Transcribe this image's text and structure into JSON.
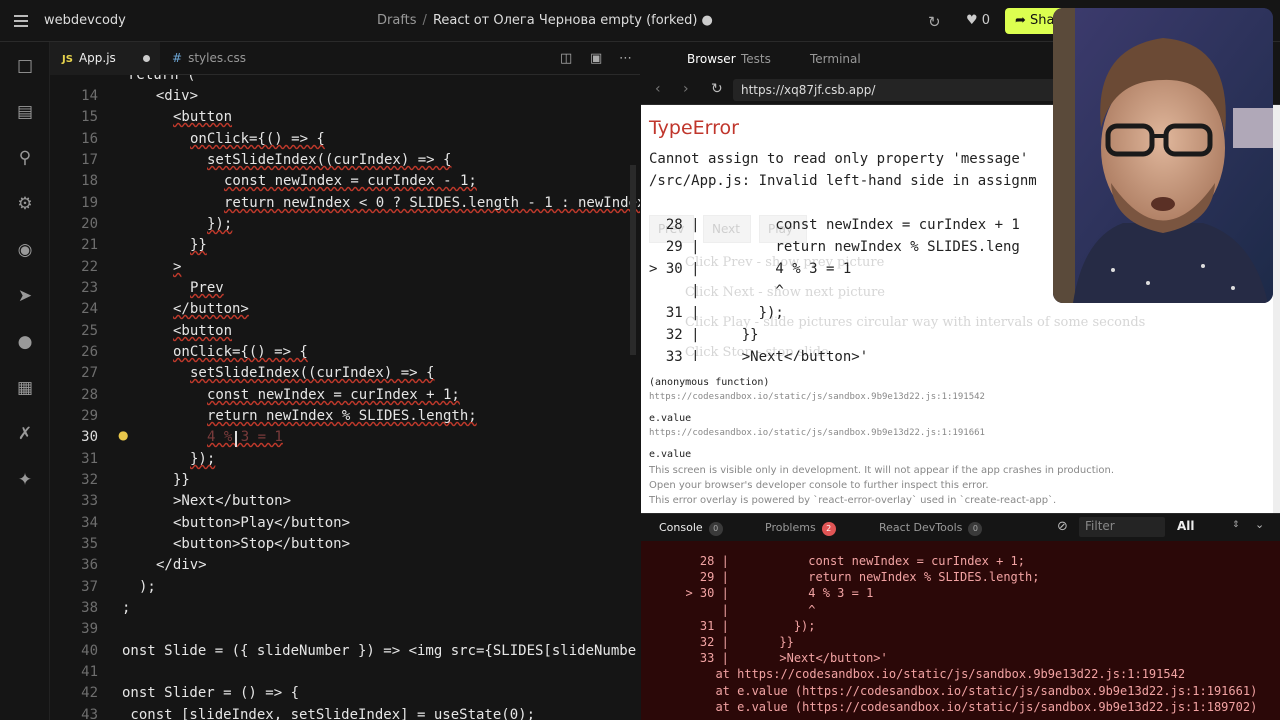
{
  "topbar": {
    "workspace": "webdevcody",
    "breadcrumb_root": "Drafts",
    "breadcrumb_sep": "/",
    "sandbox_title": "React от Олега Чернова empty (forked)",
    "likes": "0",
    "share_label": "Share"
  },
  "editor": {
    "tabs": [
      {
        "label": "App.js",
        "badge": "JS"
      },
      {
        "label": "styles.css",
        "badge": "#"
      }
    ],
    "lines": [
      {
        "num": "14",
        "code": "  <div>",
        "indent": 1
      },
      {
        "num": "15",
        "code": "<button",
        "indent": 3
      },
      {
        "num": "16",
        "code": "onClick={() => {",
        "indent": 4
      },
      {
        "num": "17",
        "code": "setSlideIndex((curIndex) => {",
        "indent": 5
      },
      {
        "num": "18",
        "code": "const newIndex = curIndex - 1;",
        "indent": 6
      },
      {
        "num": "19",
        "code": "return newIndex < 0 ? SLIDES.length - 1 : newIndex",
        "indent": 6
      },
      {
        "num": "20",
        "code": "});",
        "indent": 5
      },
      {
        "num": "21",
        "code": "}}",
        "indent": 4
      },
      {
        "num": "22",
        "code": ">",
        "indent": 3
      },
      {
        "num": "23",
        "code": "Prev",
        "indent": 4
      },
      {
        "num": "24",
        "code": "</button>",
        "indent": 3
      },
      {
        "num": "25",
        "code": "<button",
        "indent": 3
      },
      {
        "num": "26",
        "code": "onClick={() => {",
        "indent": 3
      },
      {
        "num": "27",
        "code": "setSlideIndex((curIndex) => {",
        "indent": 4
      },
      {
        "num": "28",
        "code": "const newIndex = curIndex + 1;",
        "indent": 5
      },
      {
        "num": "29",
        "code": "return newIndex % SLIDES.length;",
        "indent": 5
      },
      {
        "num": "30",
        "code": "4 % 3 = 1",
        "indent": 5
      },
      {
        "num": "31",
        "code": "});",
        "indent": 4
      },
      {
        "num": "32",
        "code": "}}",
        "indent": 3
      },
      {
        "num": "33",
        "code": ">Next</button>",
        "indent": 3
      },
      {
        "num": "34",
        "code": "<button>Play</button>",
        "indent": 3
      },
      {
        "num": "35",
        "code": "<button>Stop</button>",
        "indent": 3
      },
      {
        "num": "36",
        "code": "</div>",
        "indent": 2
      },
      {
        "num": "37",
        "code": ");",
        "indent": 1
      },
      {
        "num": "38",
        "code": ";",
        "indent": 0
      },
      {
        "num": "39",
        "code": "",
        "indent": 0
      },
      {
        "num": "40",
        "code": "onst Slide = ({ slideNumber }) => <img src={SLIDES[slideNumbe",
        "indent": 0
      },
      {
        "num": "41",
        "code": "",
        "indent": 0
      },
      {
        "num": "42",
        "code": "onst Slider = () => {",
        "indent": 0
      },
      {
        "num": "43",
        "code": " const [slideIndex, setSlideIndex] = useState(0);",
        "indent": 0
      }
    ]
  },
  "preview": {
    "tabs": [
      "Browser",
      "Tests",
      "Terminal"
    ],
    "url": "https://xq87jf.csb.app/",
    "error_title": "TypeError",
    "error_line1": "Cannot assign to read only property 'message'",
    "error_line2": "/src/App.js: Invalid left-hand side in assignm",
    "frame_lines": [
      "  28 |         const newIndex = curIndex + 1",
      "  29 |         return newIndex % SLIDES.leng",
      "> 30 |         4 % 3 = 1",
      "     |         ^",
      "  31 |       });",
      "  32 |     }}",
      "  33 |     >Next</button>'"
    ],
    "ghost": {
      "btn1": "Prev",
      "btn2": "Next",
      "btn3": "Play",
      "item1": "Click Prev - show prev picture",
      "item2": "Click Next - show next picture",
      "item3": "Click Play - slide pictures circular way with intervals of some seconds",
      "item4": "Click Stop - stop slide"
    },
    "stack": [
      {
        "fn": "(anonymous function)",
        "url": "https://codesandbox.io/static/js/sandbox.9b9e13d22.js:1:191542"
      },
      {
        "fn": "e.value",
        "url": "https://codesandbox.io/static/js/sandbox.9b9e13d22.js:1:191661"
      },
      {
        "fn": "e.value",
        "url": ""
      }
    ],
    "footer": [
      "This screen is visible only in development. It will not appear if the app crashes in production.",
      "Open your browser's developer console to further inspect this error.",
      "This error overlay is powered by `react-error-overlay` used in `create-react-app`."
    ]
  },
  "console": {
    "tabs": [
      {
        "label": "Console",
        "count": "0"
      },
      {
        "label": "Problems",
        "count": "2"
      },
      {
        "label": "React DevTools",
        "count": "0"
      }
    ],
    "filter_placeholder": "Filter",
    "level": "All",
    "lines": [
      "    28 |           const newIndex = curIndex + 1;",
      "    29 |           return newIndex % SLIDES.length;",
      "  > 30 |           4 % 3 = 1",
      "       |           ^",
      "    31 |         });",
      "    32 |       }}",
      "    33 |       >Next</button>'",
      "  at https://codesandbox.io/static/js/sandbox.9b9e13d22.js:1:191542",
      "  at e.value (https://codesandbox.io/static/js/sandbox.9b9e13d22.js:1:191661)",
      "  at e.value (https://codesandbox.io/static/js/sandbox.9b9e13d22.js:1:189702)"
    ]
  },
  "colors": {
    "accent_share": "#dcff50",
    "error_red": "#c0362c",
    "console_bg": "#2b0808"
  }
}
